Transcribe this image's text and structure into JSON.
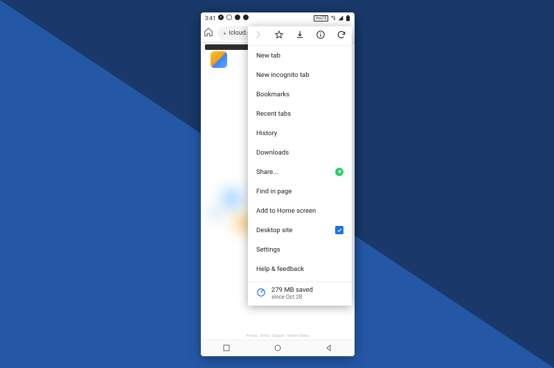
{
  "status": {
    "time": "3:41",
    "battery_box": "▮"
  },
  "browser": {
    "url_display": "icloud.c"
  },
  "menu": {
    "items": {
      "new_tab": "New tab",
      "incognito": "New incognito tab",
      "bookmarks": "Bookmarks",
      "recent_tabs": "Recent tabs",
      "history": "History",
      "downloads": "Downloads",
      "share": "Share...",
      "find_in_page": "Find in page",
      "add_home": "Add to Home screen",
      "desktop_site": "Desktop site",
      "settings": "Settings",
      "help": "Help & feedback"
    },
    "desktop_site_checked": true,
    "data_saved": {
      "main": "279 MB saved",
      "sub": "since Oct 28"
    }
  },
  "footer": "Privacy  ·  Terms  ·  Support  ·  System Status"
}
